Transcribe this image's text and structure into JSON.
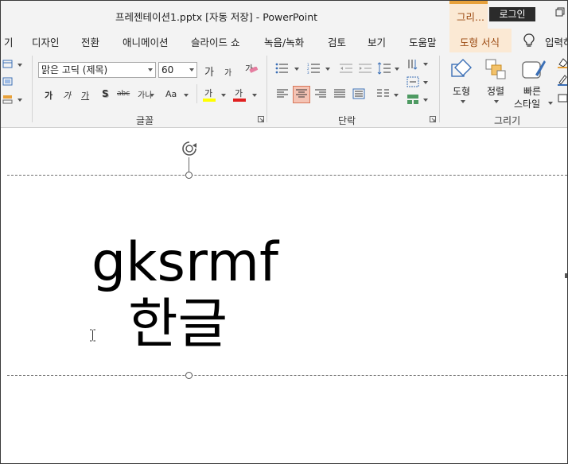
{
  "window": {
    "title": "프레젠테이션1.pptx [자동 저장]  -  PowerPoint",
    "contextual_group": "그리...",
    "login_label": "로그인"
  },
  "tabs": {
    "items": [
      "기",
      "디자인",
      "전환",
      "애니메이션",
      "슬라이드 쇼",
      "녹음/녹화",
      "검토",
      "보기",
      "도움말"
    ],
    "contextual": "도형 서식",
    "tell_me": "입력하"
  },
  "ribbon": {
    "font_group": {
      "label": "글꼴",
      "font_name": "맑은 고딕 (제목)",
      "font_size": "60",
      "grow_font": "가",
      "shrink_font": "가",
      "clear_format": "가",
      "bold": "가",
      "italic": "가",
      "underline": "가",
      "shadow": "S",
      "strikethrough": "abc",
      "char_spacing": "가나",
      "change_case": "Aa",
      "highlight": "가",
      "font_color": "가"
    },
    "paragraph_group": {
      "label": "단락"
    },
    "drawing_group": {
      "label": "그리기",
      "shapes_label": "도형",
      "arrange_label": "정렬",
      "quick_styles_label_1": "빠른",
      "quick_styles_label_2": "스타일"
    },
    "colors": {
      "highlight": "#ffff00",
      "font_color": "#e02020",
      "active_align": "#f4c3b4"
    }
  },
  "slide": {
    "text_line1": "gksrmf",
    "text_line2": "한글"
  }
}
